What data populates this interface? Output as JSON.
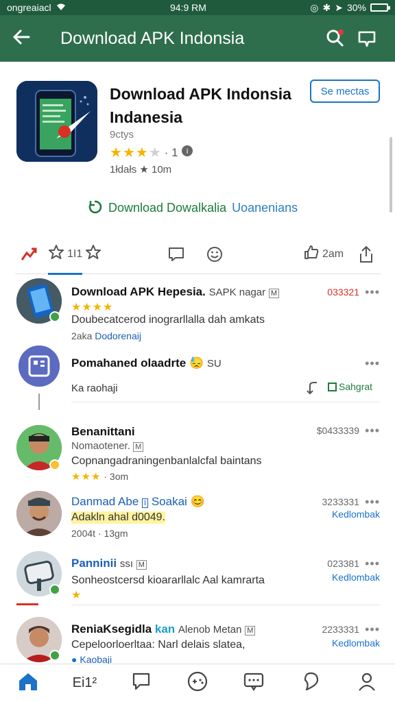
{
  "status_bar": {
    "carrier": "ongreaiacl",
    "time": "94:9 RM",
    "battery": "30%"
  },
  "app_bar": {
    "title": "Download APK Indonsia"
  },
  "app": {
    "name_line1": "Download APK Indonsia",
    "name_line2": "Indanesia",
    "subtitle": "9ctys",
    "rating_stars": 3,
    "rating_count": "· 1",
    "downloads": "1łdałs ★ 10m",
    "more_button": "Se mectas",
    "download_link_main": "Download Dowalkalia",
    "download_link_rest": "Uoanenians"
  },
  "actions": {
    "tab_count": "1I1",
    "share_label": "2am"
  },
  "list": [
    {
      "title": "Download APK Hepesia.",
      "title_light": "SAPK nagar",
      "tag": "M",
      "code": "033321",
      "line1": "Doubecatcerod inograrllalla dah amkats",
      "meta": "2aka",
      "meta_link": "Dodorenaij",
      "stars": 4
    },
    {
      "title": "Pomahaned olaadrte",
      "title_suffix": "SU",
      "line1": "Ka raohaji",
      "action": "Sahgrat"
    },
    {
      "title": "Benanittani",
      "line1": "Nomaotener.",
      "tag": "M",
      "code": "$0433339",
      "line2": "Copnangadraningenbanlalcfal baintans",
      "meta": "· 3om",
      "stars": 3
    },
    {
      "title": "Danmad Abe",
      "title_light": "Soakai",
      "code": "3233331",
      "line1": "Adakln ahal d0049.",
      "meta": "2004t · 13gm",
      "link": "Kedlombak"
    },
    {
      "title": "Panninii",
      "title_light": "ssı",
      "tag": "M",
      "code": "023381",
      "line1": "Sonheostcersd kioararllalc Aal kamrarta",
      "link": "Kedlombak",
      "stars": 1
    },
    {
      "title": "ReniaKsegidla",
      "title_blue": "kan",
      "title_light": "Alenob Metan",
      "tag": "M",
      "code": "2233331",
      "line1": "Cepeloorloerltaa: Narl delais slatea,",
      "meta_link": "Kaobaji",
      "link": "Kedlombak"
    }
  ],
  "bottom_nav": {
    "tab2_label": "Ei1²"
  },
  "colors": {
    "app_bar": "#2e6e4c",
    "status_bar": "#1f5a3c",
    "accent": "#1a73c8",
    "download_green": "#1e7a3c",
    "star": "#f5b400"
  }
}
